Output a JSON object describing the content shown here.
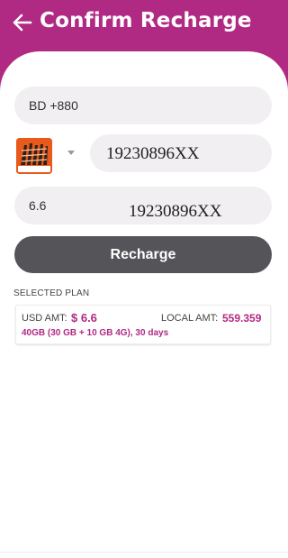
{
  "header": {
    "title": "Confirm Recharge",
    "back_icon": "arrow-left-icon",
    "color": "#b02a83"
  },
  "form": {
    "country_code": "BD +880",
    "operator": {
      "logo_icon": "operator-logo-icon",
      "logo_color": "#e8591c",
      "dropdown_icon": "caret-down-icon"
    },
    "phone_number": "19230896XX",
    "amount": "6.6",
    "amount_phone_number": "19230896XX"
  },
  "actions": {
    "recharge_label": "Recharge",
    "button_color": "#555458"
  },
  "plan": {
    "section_label": "SELECTED PLAN",
    "usd_label": "USD AMT:",
    "usd_value": "$ 6.6",
    "local_label": "LOCAL AMT:",
    "local_value": "559.359",
    "description": "40GB (30 GB + 10 GB 4G), 30 days",
    "accent_color": "#b02a83"
  }
}
